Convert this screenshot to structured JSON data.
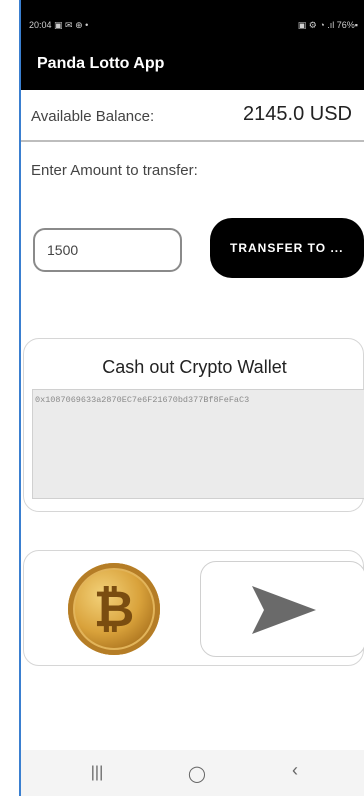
{
  "statusbar": {
    "time": "20:04",
    "left_icons": "▣ ✉ ⊕ •",
    "right_icons": "▣ ⚙ ◔ .ıl 76%▪"
  },
  "appbar": {
    "title": "Panda Lotto App"
  },
  "balance": {
    "label": "Available Balance:",
    "value": "2145.0 USD"
  },
  "transfer": {
    "prompt": "Enter Amount to transfer:",
    "amount_value": "1500",
    "button_label": "TRANSFER TO ..."
  },
  "wallet": {
    "title": "Cash out Crypto Wallet",
    "address": "0x1087069633a2870EC7e6F21670bd377Bf8FeFaC3"
  },
  "actions": {
    "coin_icon": "bitcoin-coin-icon",
    "send_icon": "send-arrow-icon"
  },
  "navbar": {
    "recents": "|||",
    "home": "◯",
    "back": "‹"
  },
  "colors": {
    "appbar": "#000000",
    "button": "#000000",
    "wallet_field": "#ebebeb",
    "frame_edge": "#3a7fd0"
  }
}
